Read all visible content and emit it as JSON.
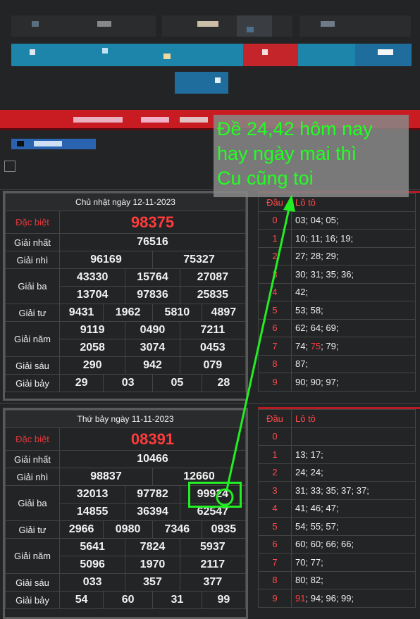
{
  "callout": {
    "lines": [
      "Đề 24,42 hôm nay",
      "hay ngày mai thì",
      "Cu cũng toi"
    ]
  },
  "result1": {
    "header": "Chủ nhật ngày 12-11-2023",
    "labels": [
      "Đặc biệt",
      "Giải nhất",
      "Giải nhì",
      "Giải ba",
      "Giải tư",
      "Giải năm",
      "Giải sáu",
      "Giải bảy"
    ],
    "db": "98375",
    "nhat": "76516",
    "nhi": [
      "96169",
      "75327"
    ],
    "ba": [
      "43330",
      "15764",
      "27087",
      "13704",
      "97836",
      "25835"
    ],
    "tu": [
      "9431",
      "1962",
      "5810",
      "4897"
    ],
    "nam": [
      "9119",
      "0490",
      "7211",
      "2058",
      "3074",
      "0453"
    ],
    "sau": [
      "290",
      "942",
      "079"
    ],
    "bay": [
      "29",
      "03",
      "05",
      "28"
    ]
  },
  "loto1": {
    "head": [
      "Đầu",
      "Lô tô"
    ],
    "rows": [
      {
        "d": "0",
        "v": "03; 04; 05;"
      },
      {
        "d": "1",
        "v": "10; 11; 16; 19;"
      },
      {
        "d": "2",
        "v": "27; 28; 29;"
      },
      {
        "d": "3",
        "v": "30; 31; 35; 36;"
      },
      {
        "d": "4",
        "v": "42;"
      },
      {
        "d": "5",
        "v": "53; 58;"
      },
      {
        "d": "6",
        "v": "62; 64; 69;"
      },
      {
        "d": "7",
        "a": "74; ",
        "hl": "75",
        "b": "; 79;"
      },
      {
        "d": "8",
        "v": "87;"
      },
      {
        "d": "9",
        "v": "90; 90; 97;"
      }
    ]
  },
  "result2": {
    "header": "Thứ bảy ngày 11-11-2023",
    "labels": [
      "Đặc biệt",
      "Giải nhất",
      "Giải nhì",
      "Giải ba",
      "Giải tư",
      "Giải năm",
      "Giải sáu",
      "Giải bảy"
    ],
    "db": "08391",
    "nhat": "10466",
    "nhi": [
      "98837",
      "12660"
    ],
    "ba": [
      "32013",
      "97782",
      "99924",
      "14855",
      "36394",
      "62547"
    ],
    "tu": [
      "2966",
      "0980",
      "7346",
      "0935"
    ],
    "nam": [
      "5641",
      "7824",
      "5937",
      "5096",
      "1970",
      "2117"
    ],
    "sau": [
      "033",
      "357",
      "377"
    ],
    "bay": [
      "54",
      "60",
      "31",
      "99"
    ]
  },
  "loto2": {
    "head": [
      "Đầu",
      "Lô tô"
    ],
    "rows": [
      {
        "d": "0",
        "v": ""
      },
      {
        "d": "1",
        "v": "13; 17;"
      },
      {
        "d": "2",
        "v": "24; 24;"
      },
      {
        "d": "3",
        "v": "31; 33; 35; 37; 37;"
      },
      {
        "d": "4",
        "v": "41; 46; 47;"
      },
      {
        "d": "5",
        "v": "54; 55; 57;"
      },
      {
        "d": "6",
        "v": "60; 60; 66; 66;"
      },
      {
        "d": "7",
        "v": "70; 77;"
      },
      {
        "d": "8",
        "v": "80; 82;"
      },
      {
        "d": "9",
        "hl": "91",
        "b": "; 94; 96; 99;"
      }
    ]
  },
  "colors": {
    "accent_red": "#ff3b3b",
    "annotation_green": "#22ee22",
    "nav_blue": "#1d84aa"
  }
}
